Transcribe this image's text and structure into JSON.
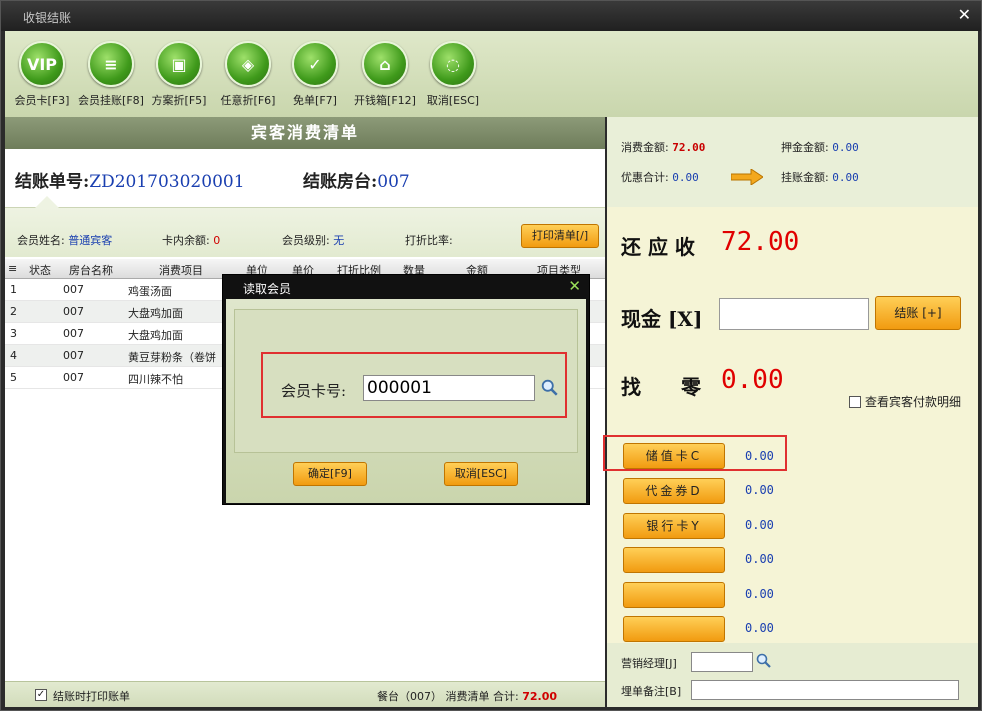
{
  "window": {
    "title": "收银结账",
    "close_glyph": "✕"
  },
  "toolbar": [
    {
      "label": "会员卡[F3]",
      "icon": "vip-icon",
      "glyph": "VIP"
    },
    {
      "label": "会员挂账[F8]",
      "icon": "document-icon",
      "glyph": "≡"
    },
    {
      "label": "方案折[F5]",
      "icon": "window-icon",
      "glyph": "▣"
    },
    {
      "label": "任意折[F6]",
      "icon": "pot-icon",
      "glyph": "◈"
    },
    {
      "label": "免单[F7]",
      "icon": "bag-icon",
      "glyph": "✓"
    },
    {
      "label": "开钱箱[F12]",
      "icon": "safe-icon",
      "glyph": "⌂"
    },
    {
      "label": "取消[ESC]",
      "icon": "cancel-icon",
      "glyph": "◌"
    }
  ],
  "bill": {
    "header": "宾客消费清单",
    "bill_no_label": "结账单号:",
    "bill_no": "ZD201703020001",
    "table_label": "结账房台:",
    "table_no": "007"
  },
  "member": {
    "name_label": "会员姓名:",
    "name": "普通宾客",
    "balance_label": "卡内余额:",
    "balance": "0",
    "level_label": "会员级别:",
    "level": "无",
    "discount_label": "打折比率:",
    "print_button": "打印清单[/]"
  },
  "grid": {
    "headers": [
      "≡",
      "状态",
      "房台名称",
      "消费项目",
      "单位",
      "单价",
      "打折比例",
      "数量",
      "金额",
      "项目类型"
    ],
    "rows": [
      {
        "idx": "1",
        "room": "007",
        "item": "鸡蛋汤面"
      },
      {
        "idx": "2",
        "room": "007",
        "item": "大盘鸡加面"
      },
      {
        "idx": "3",
        "room": "007",
        "item": "大盘鸡加面"
      },
      {
        "idx": "4",
        "room": "007",
        "item": "黄豆芽粉条（卷饼"
      },
      {
        "idx": "5",
        "room": "007",
        "item": "四川辣不怕"
      }
    ]
  },
  "footer": {
    "print_on_checkout": "结账时打印账单",
    "summary": "餐台（007） 消费清单 合计:",
    "total": "72.00"
  },
  "summary": {
    "consume_label": "消费金额:",
    "consume": "72.00",
    "deposit_label": "押金金额:",
    "deposit": "0.00",
    "discount_label": "优惠合计:",
    "discount": "0.00",
    "credit_label": "挂账金额:",
    "credit": "0.00"
  },
  "payment": {
    "due_label": "还 应 收",
    "due": "72.00",
    "cash_label": "现金 [X]",
    "checkout_button": "结账 [+]",
    "change_label": "找　　零",
    "change": "0.00",
    "detail_checkbox": "查看宾客付款明细",
    "methods": [
      {
        "label": "储值卡C",
        "value": "0.00"
      },
      {
        "label": "代金券D",
        "value": "0.00"
      },
      {
        "label": "银行卡Y",
        "value": "0.00"
      },
      {
        "label": "",
        "value": "0.00"
      },
      {
        "label": "",
        "value": "0.00"
      },
      {
        "label": "",
        "value": "0.00"
      }
    ],
    "manager_label": "营销经理[J]",
    "remark_label": "埋单备注[B]"
  },
  "dialog": {
    "title": "读取会员",
    "card_label": "会员卡号:",
    "card_value": "000001",
    "ok_button": "确定[F9]",
    "cancel_button": "取消[ESC]"
  },
  "colors": {
    "accent_orange": "#f19b10",
    "amount_red": "#e00000",
    "value_blue": "#1a3fb0",
    "highlight": "#e03030"
  }
}
